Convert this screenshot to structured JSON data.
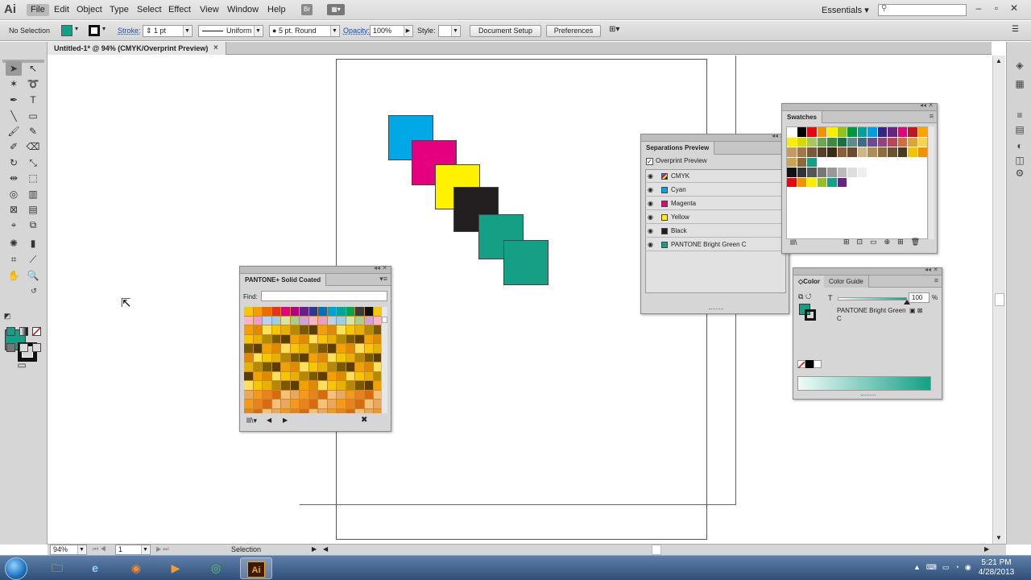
{
  "app": {
    "logo": "Ai"
  },
  "menu": {
    "items": [
      "File",
      "Edit",
      "Object",
      "Type",
      "Select",
      "Effect",
      "View",
      "Window",
      "Help"
    ],
    "bridge_label": "Br",
    "workspace": "Essentials ▾"
  },
  "control_bar": {
    "selection": "No Selection",
    "stroke_label": "Stroke:",
    "stroke_weight": "1 pt",
    "stroke_profile": "Uniform",
    "brush": "5 pt. Round",
    "opacity_label": "Opacity:",
    "opacity": "100%",
    "style_label": "Style:",
    "document_setup": "Document Setup",
    "preferences": "Preferences"
  },
  "document": {
    "tab_title": "Untitled-1* @ 94% (CMYK/Overprint Preview)",
    "close": "×"
  },
  "status_bar": {
    "zoom": "94%",
    "artboard": "1",
    "tool": "Selection"
  },
  "colors": {
    "fill": "#14a085",
    "cyan": "#00a8e6",
    "magenta": "#e4007f",
    "yellow": "#fff100",
    "black": "#231f20",
    "pantone_green": "#14a085"
  },
  "pantone_panel": {
    "title": "PANTONE+ Solid Coated",
    "find_label": "Find:"
  },
  "separations_panel": {
    "title": "Separations Preview",
    "overprint": "Overprint Preview",
    "rows": [
      {
        "label": "CMYK",
        "color": "#888888"
      },
      {
        "label": "Cyan",
        "color": "#00a8e6"
      },
      {
        "label": "Magenta",
        "color": "#e4007f"
      },
      {
        "label": "Yellow",
        "color": "#fff100"
      },
      {
        "label": "Black",
        "color": "#231f20"
      },
      {
        "label": "PANTONE Bright Green C",
        "color": "#14a085"
      }
    ]
  },
  "swatches_panel": {
    "title": "Swatches"
  },
  "color_panel": {
    "tab_color": "Color",
    "tab_guide": "Color Guide",
    "tint_label": "T",
    "tint_value": "100",
    "percent": "%",
    "swatch_name": "PANTONE Bright Green C"
  },
  "taskbar": {
    "time": "5:21 PM",
    "date": "4/28/2013",
    "ai_label": "Ai"
  }
}
